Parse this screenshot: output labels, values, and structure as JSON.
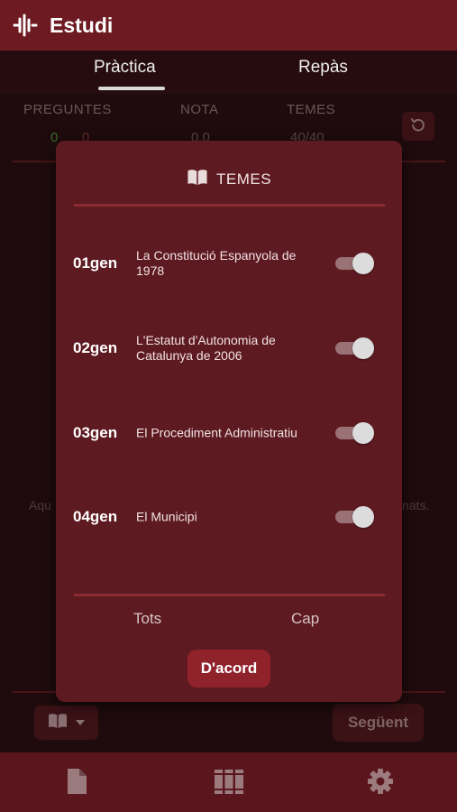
{
  "app": {
    "title": "Estudi",
    "logo_icon": "soundwave-icon"
  },
  "tabs": [
    {
      "label": "Pràctica",
      "active": true
    },
    {
      "label": "Repàs",
      "active": false
    }
  ],
  "stats": {
    "labels": [
      "PREGUNTES",
      "NOTA",
      "TEMES"
    ],
    "preguntes_correct": "0",
    "preguntes_wrong": "0",
    "nota": "0,0",
    "temes": "40/40"
  },
  "background": {
    "left_text": "Aqu",
    "right_text": "nats."
  },
  "dialog": {
    "title": "TEMES",
    "items": [
      {
        "code": "01gen",
        "name": "La Constitució Espanyola de 1978",
        "enabled": true
      },
      {
        "code": "02gen",
        "name": "L'Estatut d'Autonomia de Catalunya de 2006",
        "enabled": true
      },
      {
        "code": "03gen",
        "name": "El Procediment Administratiu",
        "enabled": true
      },
      {
        "code": "04gen",
        "name": "El Municipi",
        "enabled": true
      }
    ],
    "all_label": "Tots",
    "none_label": "Cap",
    "ok_label": "D'acord"
  },
  "footer": {
    "next_label": "Següent"
  },
  "bottom_nav": [
    "document-icon",
    "books-icon",
    "gear-icon"
  ],
  "colors": {
    "appbar": "#6e1a22",
    "dialog": "#5e1a21",
    "accent": "#8f222b"
  }
}
